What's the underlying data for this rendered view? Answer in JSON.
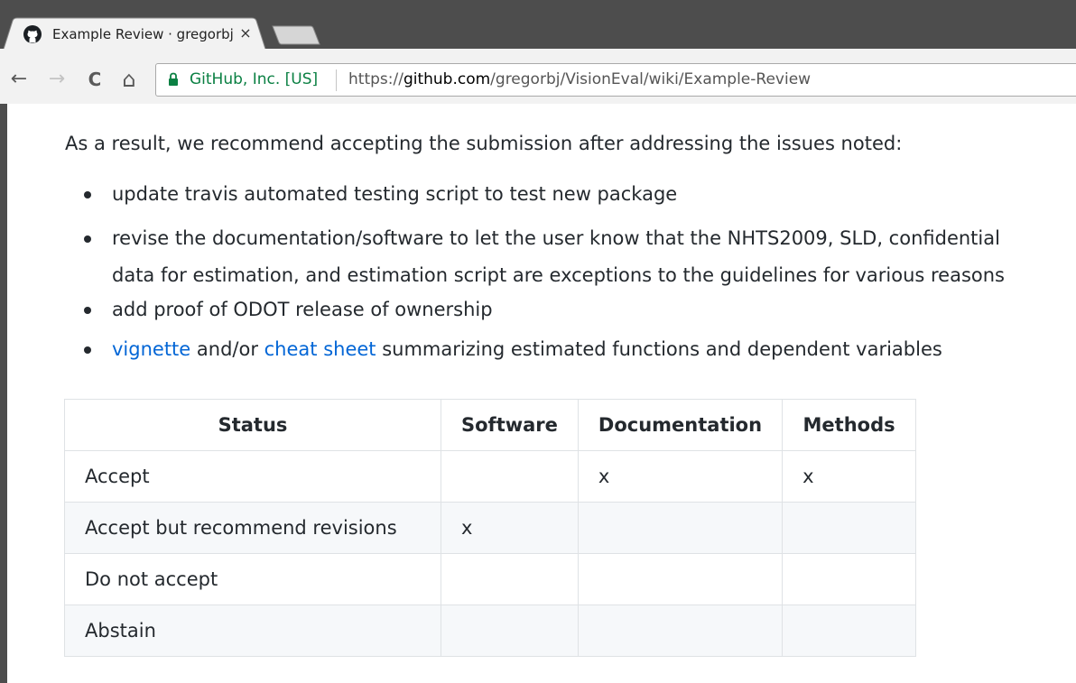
{
  "tab": {
    "title": "Example Review · gregorbj/VisionEval Wiki",
    "close_label": "×"
  },
  "toolbar": {
    "back_label": "←",
    "forward_label": "→",
    "reload_label": "C",
    "home_label": "⌂",
    "secure_label": "GitHub, Inc. [US]",
    "url_scheme": "https://",
    "url_host": "github.com",
    "url_path": "/gregorbj/VisionEval/wiki/Example-Review"
  },
  "page": {
    "intro": "As a result, we recommend accepting the submission after addressing the issues noted:",
    "items": [
      {
        "text": "update travis automated testing script to test new package"
      },
      {
        "line1": "revise the documentation/software to let the user know that the NHTS2009, SLD, confidential",
        "line2": "data for estimation, and estimation script are exceptions to the guidelines for various reasons"
      },
      {
        "text": "add proof of ODOT release of ownership"
      },
      {
        "link1": "vignette",
        "mid": " and/or ",
        "link2": "cheat sheet",
        "rest": " summarizing estimated functions and dependent variables"
      }
    ],
    "table": {
      "headers": [
        "Status",
        "Software",
        "Documentation",
        "Methods"
      ],
      "rows": [
        [
          "Accept",
          "",
          "x",
          "x"
        ],
        [
          "Accept but recommend revisions",
          "x",
          "",
          ""
        ],
        [
          "Do not accept",
          "",
          "",
          ""
        ],
        [
          "Abstain",
          "",
          "",
          ""
        ]
      ]
    }
  },
  "colors": {
    "link": "#0366d6",
    "secure": "#0b8043",
    "text": "#24292e",
    "chrome": "#f2f2f2"
  }
}
